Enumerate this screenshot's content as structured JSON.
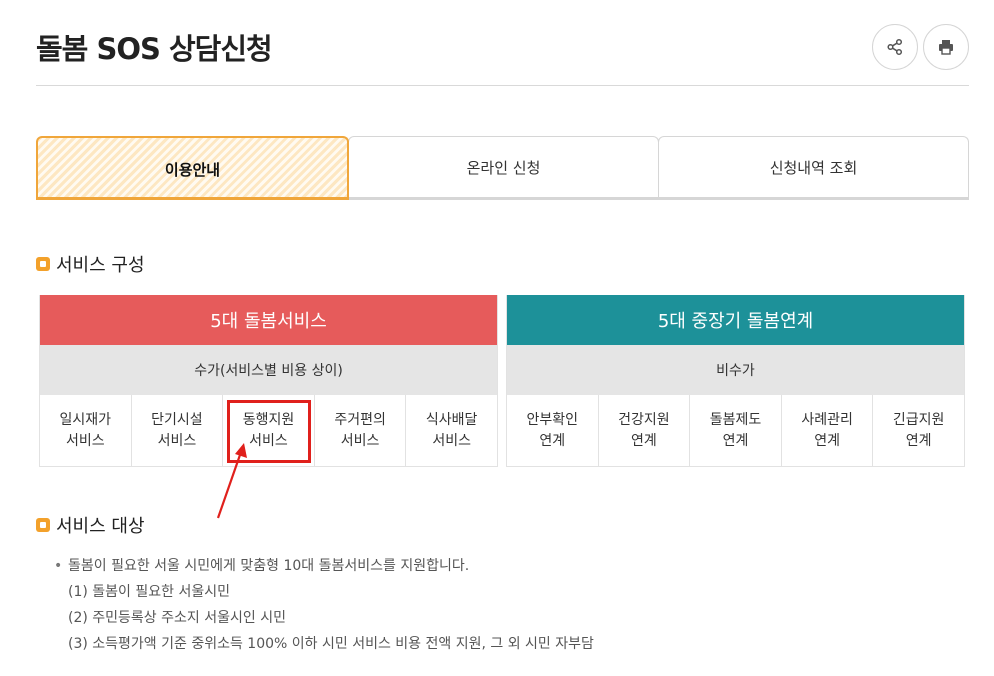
{
  "page": {
    "title": "돌봄 SOS 상담신청"
  },
  "actions": {
    "share_icon": "share-icon",
    "print_icon": "print-icon"
  },
  "tabs": [
    {
      "label": "이용안내",
      "active": true
    },
    {
      "label": "온라인 신청",
      "active": false
    },
    {
      "label": "신청내역 조회",
      "active": false
    }
  ],
  "service_section": {
    "heading": "서비스 구성",
    "left": {
      "title": "5대 돌봄서비스",
      "subtitle": "수가(서비스별 비용 상이)",
      "items": [
        "일시재가\n서비스",
        "단기시설\n서비스",
        "동행지원\n서비스",
        "주거편의\n서비스",
        "식사배달\n서비스"
      ]
    },
    "right": {
      "title": "5대 중장기 돌봄연계",
      "subtitle": "비수가",
      "items": [
        "안부확인\n연계",
        "건강지원\n연계",
        "돌봄제도\n연계",
        "사례관리\n연계",
        "긴급지원\n연계"
      ]
    }
  },
  "target_section": {
    "heading": "서비스 대상",
    "main": "돌봄이 필요한 서울 시민에게 맞춤형 10대 돌봄서비스를 지원합니다.",
    "items": [
      "(1) 돌봄이 필요한 서울시민",
      "(2) 주민등록상 주소지 서울시인 시민",
      "(3) 소득평가액 기준 중위소득 100% 이하 시민 서비스 비용 전액 지원, 그 외 시민 자부담"
    ]
  },
  "colors": {
    "accent_orange": "#f0a63a",
    "left_header": "#e65b5b",
    "right_header": "#1d9199",
    "highlight": "#e0201c"
  }
}
